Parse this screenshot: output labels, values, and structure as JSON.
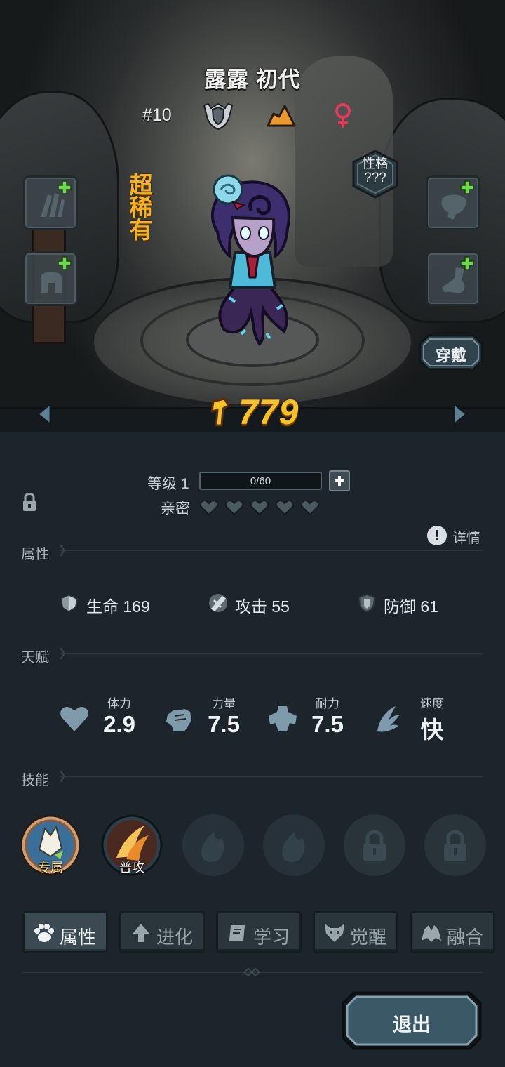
{
  "character": {
    "name": "露露 初代",
    "number": "#10",
    "rarity": "超稀有",
    "personality": "性格\n???",
    "power": "779"
  },
  "buttons": {
    "wear": "穿戴",
    "exit": "退出",
    "details": "详情"
  },
  "level": {
    "label": "等级 1",
    "xp_text": "0/60",
    "xp_fraction": 0,
    "intimacy_label": "亲密",
    "intimacy_hearts_filled": 0,
    "intimacy_hearts_total": 5
  },
  "sections": {
    "attributes": "属性",
    "talents": "天赋",
    "skills": "技能"
  },
  "stats": [
    {
      "icon": "heart-shield-icon",
      "label": "生命 169"
    },
    {
      "icon": "sword-icon",
      "label": "攻击  55"
    },
    {
      "icon": "shield-icon",
      "label": "防御  61"
    }
  ],
  "talents": [
    {
      "icon": "heart-icon",
      "label": "体力",
      "value": "2.9"
    },
    {
      "icon": "fist-icon",
      "label": "力量",
      "value": "7.5"
    },
    {
      "icon": "muscle-icon",
      "label": "耐力",
      "value": "7.5"
    },
    {
      "icon": "wing-icon",
      "label": "速度",
      "value": "快"
    }
  ],
  "skills": [
    {
      "caption": "专属",
      "state": "unlocked"
    },
    {
      "caption": "普攻",
      "state": "unlocked"
    },
    {
      "caption": "",
      "state": "empty"
    },
    {
      "caption": "",
      "state": "empty"
    },
    {
      "caption": "",
      "state": "locked"
    },
    {
      "caption": "",
      "state": "locked"
    }
  ],
  "tabs": [
    {
      "label": "属性",
      "icon": "paw-icon",
      "active": true
    },
    {
      "label": "进化",
      "icon": "arrow-up-icon",
      "active": false
    },
    {
      "label": "学习",
      "icon": "book-icon",
      "active": false
    },
    {
      "label": "觉醒",
      "icon": "wolf-icon",
      "active": false
    },
    {
      "label": "融合",
      "icon": "fusion-icon",
      "active": false
    }
  ],
  "equip_slots": [
    "claw-icon",
    "glove-icon",
    "helmet-icon",
    "boot-icon"
  ],
  "colors": {
    "rarity": "#f5b224",
    "power": "#f6c22a",
    "female": "#e23a5a",
    "plus_green": "#6ad84a",
    "panel_bg": "#1c252b"
  }
}
